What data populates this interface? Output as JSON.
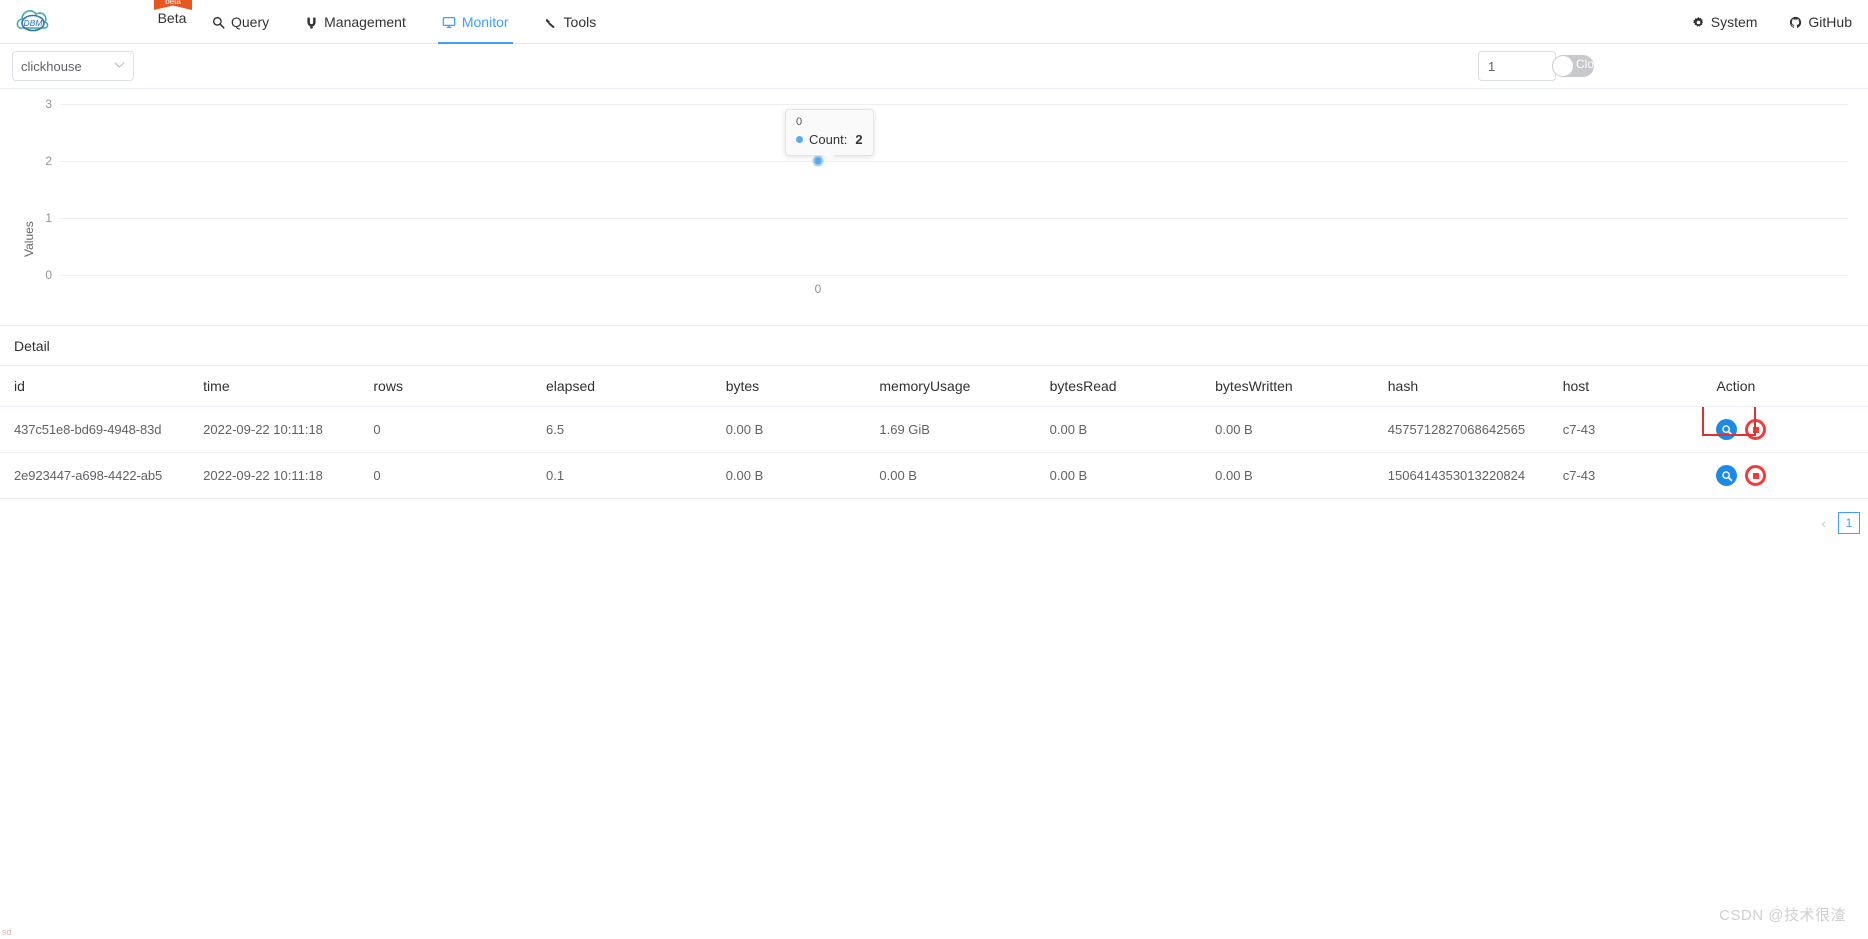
{
  "navbar": {
    "brand_label": "DBM",
    "beta_ribbon": "beta",
    "beta_label": "Beta",
    "items": [
      {
        "label": "Query",
        "icon": "search-icon",
        "active": false
      },
      {
        "label": "Management",
        "icon": "management-icon",
        "active": false
      },
      {
        "label": "Monitor",
        "icon": "monitor-icon",
        "active": true
      },
      {
        "label": "Tools",
        "icon": "tools-icon",
        "active": false
      }
    ],
    "right_items": [
      {
        "label": "System",
        "icon": "gear-icon"
      },
      {
        "label": "GitHub",
        "icon": "github-icon"
      }
    ]
  },
  "toolbar": {
    "datasource": "clickhouse",
    "datasource_caret": "∨",
    "interval_value": "1",
    "interval_placeholder": "",
    "switch_label": "Close",
    "switch_on": false
  },
  "chart_data": {
    "type": "line",
    "title": "",
    "xlabel": "",
    "ylabel": "Values",
    "x": [
      "0"
    ],
    "categories": [
      "0"
    ],
    "series": [
      {
        "name": "Count",
        "values": [
          2
        ]
      }
    ],
    "ylim": [
      0,
      3
    ],
    "yticks": [
      "3",
      "2",
      "1",
      "0"
    ],
    "xticks": [
      "0"
    ],
    "grid": true,
    "legend": "none",
    "tooltip": {
      "title": "0",
      "series_name": "Count",
      "value": "2",
      "label": "Count:",
      "color": "#5aaaf0"
    }
  },
  "detail": {
    "title": "Detail",
    "columns": [
      "id",
      "time",
      "rows",
      "elapsed",
      "bytes",
      "memoryUsage",
      "bytesRead",
      "bytesWritten",
      "hash",
      "host",
      "Action"
    ],
    "rows": [
      {
        "id": "437c51e8-bd69-4948-83d",
        "time": "2022-09-22 10:11:18",
        "rows": "0",
        "elapsed": "6.5",
        "bytes": "0.00 B",
        "memoryUsage": "1.69 GiB",
        "bytesRead": "0.00 B",
        "bytesWritten": "0.00 B",
        "hash": "4575712827068642565",
        "host": "c7-43",
        "highlighted": true
      },
      {
        "id": "2e923447-a698-4422-ab5",
        "time": "2022-09-22 10:11:18",
        "rows": "0",
        "elapsed": "0.1",
        "bytes": "0.00 B",
        "memoryUsage": "0.00 B",
        "bytesRead": "0.00 B",
        "bytesWritten": "0.00 B",
        "hash": "1506414353013220824",
        "host": "c7-43",
        "highlighted": false
      }
    ],
    "action_icons": {
      "view": "search-icon",
      "kill": "stop-icon"
    },
    "pagination": {
      "prev": "‹",
      "current_page": "1"
    }
  },
  "overlays": {
    "corner_note": "sd",
    "watermark": "CSDN @技术很渣"
  },
  "colors": {
    "accent": "#409eff",
    "view_icon": "#1d8ae8",
    "kill_icon": "#f23c3c",
    "highlight_box": "#e03131",
    "point": "#5aaaf0"
  }
}
